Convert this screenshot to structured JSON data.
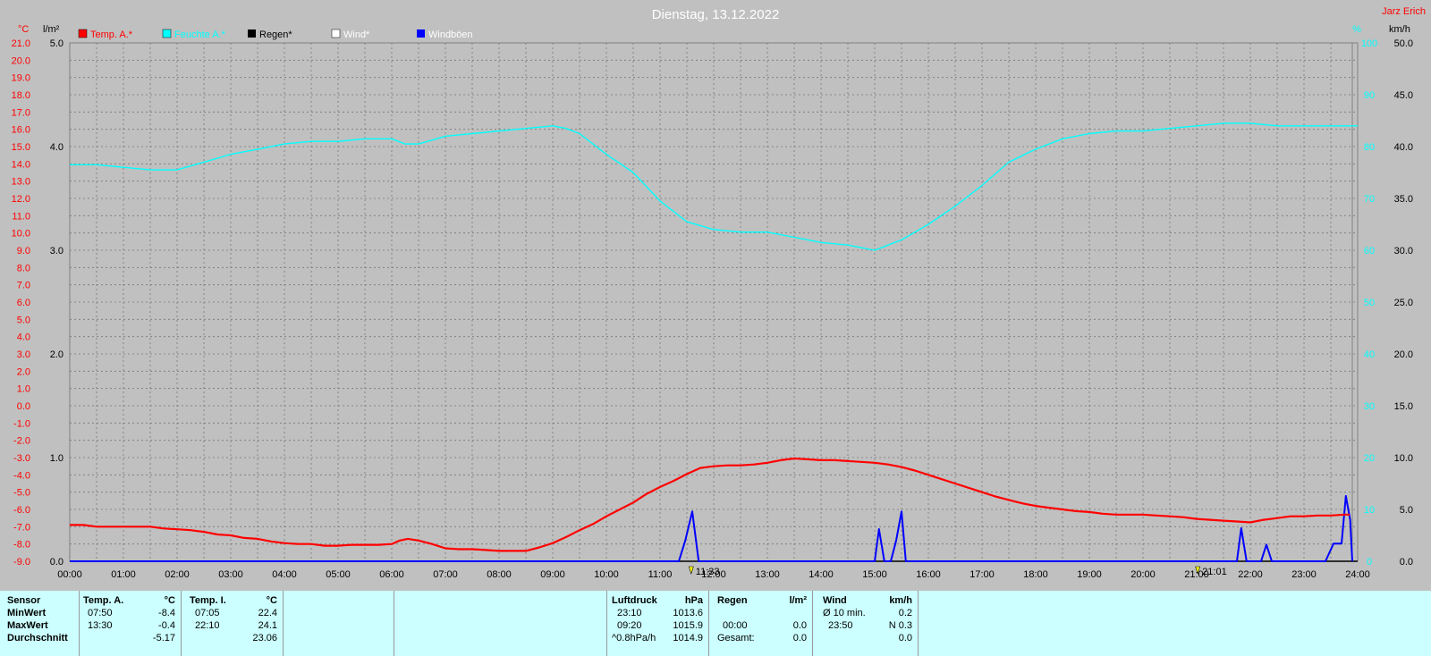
{
  "header": {
    "title": "Dienstag, 13.12.2022",
    "author": "Jarz Erich"
  },
  "legend": [
    {
      "label": "Temp. A.*",
      "color": "#ff0000"
    },
    {
      "label": "Feuchte A.*",
      "color": "#00ffff"
    },
    {
      "label": "Regen*",
      "color": "#000000"
    },
    {
      "label": "Wind*",
      "color": "#ffffff"
    },
    {
      "label": "Windböen",
      "color": "#0000ff"
    }
  ],
  "axis_units": {
    "temp": "°C",
    "rain": "l/m²",
    "hum": "%",
    "wind": "km/h"
  },
  "markers": [
    {
      "time": 11.58,
      "label": "11:33"
    },
    {
      "time": 21.02,
      "label": "21:01"
    }
  ],
  "colors": {
    "background": "#c0c0c0",
    "panel": "#ccffff",
    "temp": "#ff0000",
    "humidity": "#00ffff",
    "gust": "#0000ff"
  },
  "chart_data": {
    "type": "line",
    "title": "Dienstag, 13.12.2022",
    "x_ticks": [
      "00:00",
      "01:00",
      "02:00",
      "03:00",
      "04:00",
      "05:00",
      "06:00",
      "07:00",
      "08:00",
      "09:00",
      "10:00",
      "11:00",
      "12:00",
      "13:00",
      "14:00",
      "15:00",
      "16:00",
      "17:00",
      "18:00",
      "19:00",
      "20:00",
      "21:00",
      "22:00",
      "23:00",
      "24:00"
    ],
    "xlim": [
      0,
      24
    ],
    "grid": true,
    "axes": {
      "temp": {
        "label": "°C",
        "range": [
          -9,
          21
        ],
        "step": 1
      },
      "rain": {
        "label": "l/m²",
        "range": [
          0,
          5
        ],
        "step": 1
      },
      "hum": {
        "label": "%",
        "range": [
          0,
          100
        ],
        "step": 10
      },
      "wind": {
        "label": "km/h",
        "range": [
          0,
          50
        ],
        "step": 5
      }
    },
    "series": [
      {
        "name": "Temp. A.*",
        "axis": "temp",
        "x": [
          0,
          0.25,
          0.5,
          1,
          1.5,
          1.75,
          2,
          2.25,
          2.5,
          2.75,
          3,
          3.25,
          3.5,
          3.75,
          4,
          4.25,
          4.5,
          4.75,
          5,
          5.25,
          5.5,
          5.75,
          6,
          6.15,
          6.3,
          6.5,
          6.75,
          7,
          7.25,
          7.5,
          7.75,
          8,
          8.25,
          8.5,
          8.75,
          9,
          9.25,
          9.5,
          9.75,
          10,
          10.25,
          10.5,
          10.75,
          11,
          11.25,
          11.5,
          11.75,
          12,
          12.25,
          12.5,
          12.75,
          13,
          13.25,
          13.5,
          13.75,
          14,
          14.25,
          14.5,
          14.75,
          15,
          15.25,
          15.5,
          15.75,
          16,
          16.25,
          16.5,
          16.75,
          17,
          17.25,
          17.5,
          17.75,
          18,
          18.25,
          18.5,
          18.75,
          19,
          19.25,
          19.5,
          19.75,
          20,
          20.25,
          20.5,
          20.75,
          21,
          21.25,
          21.5,
          21.75,
          22,
          22.25,
          22.5,
          22.75,
          23,
          23.25,
          23.5,
          23.75,
          23.85
        ],
        "y": [
          -6.9,
          -6.9,
          -7.0,
          -7.0,
          -7.0,
          -7.1,
          -7.15,
          -7.2,
          -7.3,
          -7.45,
          -7.5,
          -7.65,
          -7.7,
          -7.85,
          -7.95,
          -8.0,
          -8.0,
          -8.1,
          -8.1,
          -8.05,
          -8.05,
          -8.05,
          -8.0,
          -7.8,
          -7.7,
          -7.8,
          -8.0,
          -8.25,
          -8.3,
          -8.3,
          -8.35,
          -8.4,
          -8.4,
          -8.4,
          -8.2,
          -7.95,
          -7.6,
          -7.2,
          -6.85,
          -6.4,
          -6.0,
          -5.6,
          -5.1,
          -4.7,
          -4.35,
          -3.95,
          -3.6,
          -3.5,
          -3.45,
          -3.45,
          -3.4,
          -3.3,
          -3.15,
          -3.05,
          -3.1,
          -3.15,
          -3.15,
          -3.2,
          -3.25,
          -3.3,
          -3.4,
          -3.55,
          -3.75,
          -4.0,
          -4.25,
          -4.5,
          -4.75,
          -5.0,
          -5.25,
          -5.45,
          -5.65,
          -5.8,
          -5.9,
          -6.0,
          -6.1,
          -6.15,
          -6.25,
          -6.3,
          -6.3,
          -6.3,
          -6.35,
          -6.4,
          -6.45,
          -6.55,
          -6.6,
          -6.65,
          -6.7,
          -6.75,
          -6.6,
          -6.5,
          -6.4,
          -6.4,
          -6.35,
          -6.35,
          -6.3,
          -6.3
        ]
      },
      {
        "name": "Feuchte A.*",
        "axis": "hum",
        "x": [
          0,
          0.5,
          1,
          1.5,
          2,
          2.5,
          3,
          3.5,
          4,
          4.5,
          5,
          5.5,
          6,
          6.25,
          6.5,
          7,
          7.5,
          8,
          8.5,
          9,
          9.25,
          9.5,
          10,
          10.5,
          11,
          11.5,
          12,
          12.5,
          13,
          13.5,
          14,
          14.5,
          15,
          15.25,
          15.5,
          16,
          16.5,
          17,
          17.5,
          18,
          18.5,
          19,
          19.5,
          20,
          20.5,
          21,
          21.5,
          22,
          22.5,
          23,
          23.5,
          24
        ],
        "y": [
          76.5,
          76.5,
          76,
          75.5,
          75.5,
          77,
          78.5,
          79.5,
          80.5,
          81,
          81,
          81.5,
          81.5,
          80.5,
          80.5,
          82,
          82.5,
          83,
          83.5,
          84,
          83.5,
          82.5,
          78.5,
          75,
          69.5,
          65.5,
          64,
          63.5,
          63.5,
          62.5,
          61.5,
          61,
          60,
          61,
          62,
          65,
          68.5,
          72.5,
          77,
          79.5,
          81.5,
          82.5,
          83,
          83,
          83.5,
          84,
          84.5,
          84.5,
          84,
          84,
          84,
          84
        ]
      },
      {
        "name": "Windböen",
        "axis": "wind",
        "x": [
          0,
          11.35,
          11.47,
          11.6,
          11.72,
          15.0,
          15.08,
          15.18,
          15.3,
          15.4,
          15.5,
          15.58,
          21.75,
          21.83,
          21.93,
          22.2,
          22.3,
          22.4,
          23.4,
          23.55,
          23.7,
          23.78,
          23.86,
          23.9
        ],
        "y": [
          0,
          0,
          2.0,
          4.8,
          0,
          0,
          3.1,
          0,
          0,
          2.0,
          4.8,
          0,
          0,
          3.2,
          0,
          0,
          1.6,
          0,
          0,
          1.7,
          1.7,
          6.3,
          4.0,
          0
        ]
      }
    ]
  }
}
